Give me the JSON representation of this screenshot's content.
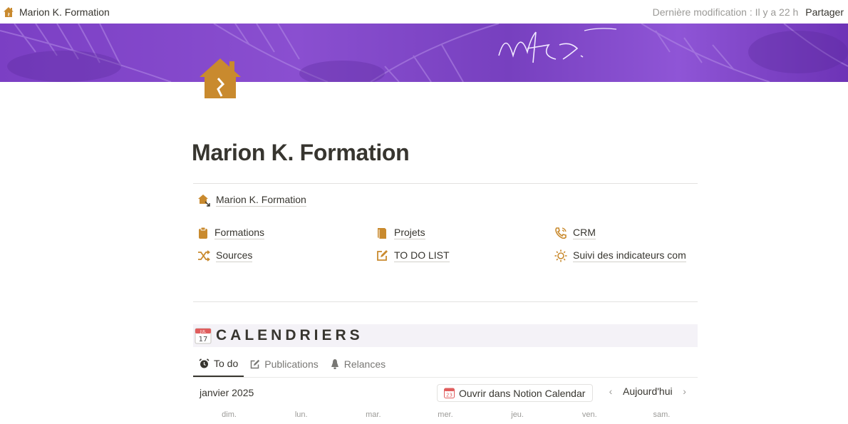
{
  "topbar": {
    "breadcrumb_title": "Marion K. Formation",
    "last_modified": "Dernière modification : Il y a 22 h",
    "share_label": "Partager"
  },
  "cover": {
    "signature_text": "MK",
    "background_color": "#8a4fd0"
  },
  "page": {
    "title": "Marion K. Formation",
    "icon": "house-icon",
    "accent_color": "#c98a2e"
  },
  "links": {
    "home": {
      "label": "Marion K. Formation",
      "icon": "house-link-icon"
    },
    "grid": [
      {
        "label": "Formations",
        "icon": "clipboard-icon"
      },
      {
        "label": "Projets",
        "icon": "book-icon"
      },
      {
        "label": "CRM",
        "icon": "phone-icon"
      },
      {
        "label": "Sources",
        "icon": "shuffle-icon"
      },
      {
        "label": "TO DO LIST",
        "icon": "edit-icon"
      },
      {
        "label": "Suivi des indicateurs com",
        "icon": "sun-icon"
      }
    ]
  },
  "calendar": {
    "heading": "CALENDRIERS",
    "calendar_icon_month": "JUL",
    "calendar_icon_day": "17",
    "tabs": [
      {
        "label": "To do",
        "icon": "alarm-icon",
        "active": true
      },
      {
        "label": "Publications",
        "icon": "edit-icon",
        "active": false
      },
      {
        "label": "Relances",
        "icon": "bell-icon",
        "active": false
      }
    ],
    "month_label": "janvier 2025",
    "open_button_label": "Ouvrir dans Notion Calendar",
    "open_button_icon_day": "23",
    "today_label": "Aujourd'hui",
    "prev_arrow": "‹",
    "next_arrow": "›",
    "weekdays": [
      "dim.",
      "lun.",
      "mar.",
      "mer.",
      "jeu.",
      "ven.",
      "sam."
    ]
  }
}
